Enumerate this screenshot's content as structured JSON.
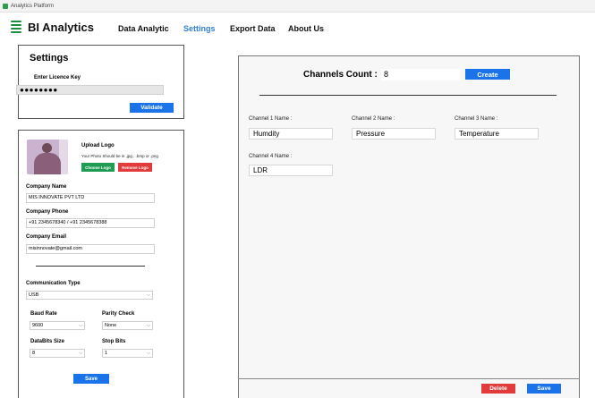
{
  "window": {
    "title": "Analytics Platform"
  },
  "brand": {
    "name": "BI Analytics"
  },
  "nav": {
    "items": [
      {
        "label": "Data Analytic",
        "active": false
      },
      {
        "label": "Settings",
        "active": true
      },
      {
        "label": "Export Data",
        "active": false
      },
      {
        "label": "About Us",
        "active": false
      }
    ]
  },
  "settings": {
    "title": "Settings",
    "licence_label": "Enter Licence Key",
    "licence_value": "●●●●●●●●",
    "validate_label": "Validate"
  },
  "profile": {
    "upload_title": "Upload Logo",
    "upload_note": "Your Photo Should  be in .jpg , .bmp or .png",
    "choose_label": "Choose Logo",
    "remove_label": "Remove Logo",
    "company_name_label": "Company Name",
    "company_name": "MIS INNOVATE PVT LTD",
    "company_phone_label": "Company Phone",
    "company_phone": "+91 2345678340  / +91 2345678388",
    "company_email_label": "Company Email",
    "company_email": "misinnovate@gmail.com",
    "comm_type_label": "Communication Type",
    "comm_type": "USB",
    "baud_rate_label": "Baud Rate",
    "baud_rate": "9600",
    "parity_label": "Parity Check",
    "parity": "None",
    "databits_label": "DataBits Size",
    "databits": "8",
    "stopbits_label": "Stop Bits",
    "stopbits": "1",
    "save_label": "Save"
  },
  "channels": {
    "count_label": "Channels Count :",
    "count_value": "8",
    "create_label": "Create",
    "items": [
      {
        "label": "Channel 1 Name :",
        "value": "Humdity"
      },
      {
        "label": "Channel 2 Name :",
        "value": "Pressure"
      },
      {
        "label": "Channel 3 Name :",
        "value": "Temperature"
      },
      {
        "label": "Channel 4 Name :",
        "value": "LDR"
      }
    ],
    "delete_label": "Delete",
    "save_label": "Save"
  },
  "icons": {
    "app": "app-icon",
    "brand": "bars-logo-icon",
    "chevron": "chevron-down-icon"
  },
  "colors": {
    "accent": "#1a73e8",
    "active_nav": "#2f7fd8",
    "green": "#1f9c54",
    "red": "#e23b3b"
  }
}
